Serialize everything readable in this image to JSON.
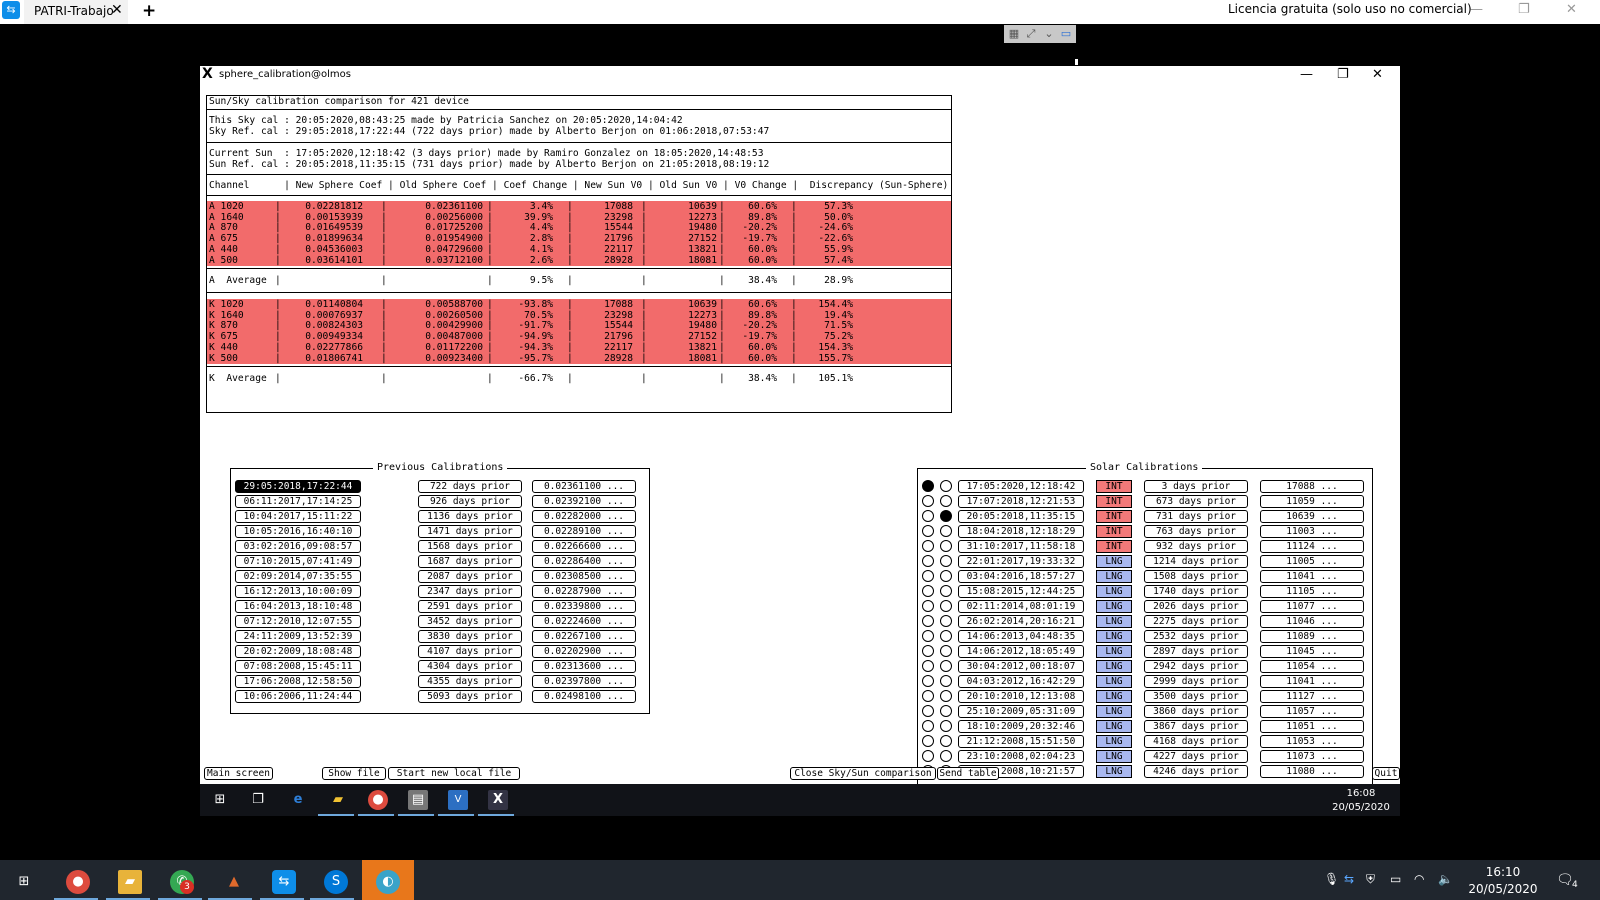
{
  "teamviewer": {
    "tab_label": "PATRI-Trabajo",
    "close_glyph": "✕",
    "new_tab_glyph": "+",
    "license_text": "Licencia gratuita (solo uso no comercial)",
    "min_glyph": "—",
    "max_glyph": "❐",
    "close_win_glyph": "✕"
  },
  "xwindow": {
    "title": "sphere_calibration@olmos",
    "min_glyph": "—",
    "max_glyph": "❐",
    "close_glyph": "✕"
  },
  "comparison": {
    "header": "Sun/Sky calibration comparison for 421 device",
    "sky_cal": "This Sky cal : 20:05:2020,08:43:25 made by Patricia Sanchez on 20:05:2020,14:04:42",
    "sky_ref": "Sky Ref. cal : 29:05:2018,17:22:44 (722 days prior) made by Alberto Berjon on 01:06:2018,07:53:47",
    "sun_cur": "Current Sun  : 17:05:2020,12:18:42 (3 days prior) made by Ramiro Gonzalez on 18:05:2020,14:48:53",
    "sun_ref": "Sun Ref. cal : 20:05:2018,11:35:15 (731 days prior) made by Alberto Berjon on 21:05:2018,08:19:12",
    "columns": "Channel      | New Sphere Coef | Old Sphere Coef | Coef Change | New Sun V0 | Old Sun V0 | V0 Change |  Discrepancy (Sun-Sphere)",
    "a_rows": [
      [
        "A 1020",
        "0.02281812",
        "0.02361100",
        "3.4%",
        "17088",
        "10639",
        "60.6%",
        "57.3%"
      ],
      [
        "A 1640",
        "0.00153939",
        "0.00256000",
        "39.9%",
        "23298",
        "12273",
        "89.8%",
        "50.0%"
      ],
      [
        "A 870",
        "0.01649539",
        "0.01725200",
        "4.4%",
        "15544",
        "19480",
        "-20.2%",
        "-24.6%"
      ],
      [
        "A 675",
        "0.01899634",
        "0.01954900",
        "2.8%",
        "21796",
        "27152",
        "-19.7%",
        "-22.6%"
      ],
      [
        "A 440",
        "0.04536003",
        "0.04729600",
        "4.1%",
        "22117",
        "13821",
        "60.0%",
        "55.9%"
      ],
      [
        "A 500",
        "0.03614101",
        "0.03712100",
        "2.6%",
        "28928",
        "18081",
        "60.0%",
        "57.4%"
      ]
    ],
    "a_avg": {
      "label": "A  Average",
      "coef": "9.5%",
      "v0": "38.4%",
      "disc": "28.9%"
    },
    "k_rows": [
      [
        "K 1020",
        "0.01140804",
        "0.00588700",
        "-93.8%",
        "17088",
        "10639",
        "60.6%",
        "154.4%"
      ],
      [
        "K 1640",
        "0.00076937",
        "0.00260500",
        "70.5%",
        "23298",
        "12273",
        "89.8%",
        "19.4%"
      ],
      [
        "K 870",
        "0.00824303",
        "0.00429900",
        "-91.7%",
        "15544",
        "19480",
        "-20.2%",
        "71.5%"
      ],
      [
        "K 675",
        "0.00949334",
        "0.00487000",
        "-94.9%",
        "21796",
        "27152",
        "-19.7%",
        "75.2%"
      ],
      [
        "K 440",
        "0.02277866",
        "0.01172200",
        "-94.3%",
        "22117",
        "13821",
        "60.0%",
        "154.3%"
      ],
      [
        "K 500",
        "0.01806741",
        "0.00923400",
        "-95.7%",
        "28928",
        "18081",
        "60.0%",
        "155.7%"
      ]
    ],
    "k_avg": {
      "label": "K  Average",
      "coef": "-66.7%",
      "v0": "38.4%",
      "disc": "105.1%"
    }
  },
  "previous": {
    "title": "Previous Calibrations",
    "rows": [
      [
        "29:05:2018,17:22:44",
        "722 days prior",
        "0.02361100 ..."
      ],
      [
        "06:11:2017,17:14:25",
        "926 days prior",
        "0.02392100 ..."
      ],
      [
        "10:04:2017,15:11:22",
        "1136 days prior",
        "0.02282000 ..."
      ],
      [
        "10:05:2016,16:40:10",
        "1471 days prior",
        "0.02289100 ..."
      ],
      [
        "03:02:2016,09:08:57",
        "1568 days prior",
        "0.02266600 ..."
      ],
      [
        "07:10:2015,07:41:49",
        "1687 days prior",
        "0.02286400 ..."
      ],
      [
        "02:09:2014,07:35:55",
        "2087 days prior",
        "0.02308500 ..."
      ],
      [
        "16:12:2013,10:00:09",
        "2347 days prior",
        "0.02287900 ..."
      ],
      [
        "16:04:2013,18:10:48",
        "2591 days prior",
        "0.02339800 ..."
      ],
      [
        "07:12:2010,12:07:55",
        "3452 days prior",
        "0.02224600 ..."
      ],
      [
        "24:11:2009,13:52:39",
        "3830 days prior",
        "0.02267100 ..."
      ],
      [
        "20:02:2009,18:08:48",
        "4107 days prior",
        "0.02202900 ..."
      ],
      [
        "07:08:2008,15:45:11",
        "4304 days prior",
        "0.02313600 ..."
      ],
      [
        "17:06:2008,12:58:50",
        "4355 days prior",
        "0.02397800 ..."
      ],
      [
        "10:06:2006,11:24:44",
        "5093 days prior",
        "0.02498100 ..."
      ]
    ]
  },
  "solar": {
    "title": "Solar Calibrations",
    "rows": [
      [
        "17:05:2020,12:18:42",
        "INT",
        "3 days prior",
        "17088 ..."
      ],
      [
        "17:07:2018,12:21:53",
        "INT",
        "673 days prior",
        "11059 ..."
      ],
      [
        "20:05:2018,11:35:15",
        "INT",
        "731 days prior",
        "10639 ..."
      ],
      [
        "18:04:2018,12:18:29",
        "INT",
        "763 days prior",
        "11003 ..."
      ],
      [
        "31:10:2017,11:58:18",
        "INT",
        "932 days prior",
        "11124 ..."
      ],
      [
        "22:01:2017,19:33:32",
        "LNG",
        "1214 days prior",
        "11005 ..."
      ],
      [
        "03:04:2016,18:57:27",
        "LNG",
        "1508 days prior",
        "11041 ..."
      ],
      [
        "15:08:2015,12:44:25",
        "LNG",
        "1740 days prior",
        "11105 ..."
      ],
      [
        "02:11:2014,08:01:19",
        "LNG",
        "2026 days prior",
        "11077 ..."
      ],
      [
        "26:02:2014,20:16:21",
        "LNG",
        "2275 days prior",
        "11046 ..."
      ],
      [
        "14:06:2013,04:48:35",
        "LNG",
        "2532 days prior",
        "11089 ..."
      ],
      [
        "14:06:2012,18:05:49",
        "LNG",
        "2897 days prior",
        "11045 ..."
      ],
      [
        "30:04:2012,00:18:07",
        "LNG",
        "2942 days prior",
        "11054 ..."
      ],
      [
        "04:03:2012,16:42:29",
        "LNG",
        "2999 days prior",
        "11041 ..."
      ],
      [
        "20:10:2010,12:13:08",
        "LNG",
        "3500 days prior",
        "11127 ..."
      ],
      [
        "25:10:2009,05:31:09",
        "LNG",
        "3860 days prior",
        "11057 ..."
      ],
      [
        "18:10:2009,20:32:46",
        "LNG",
        "3867 days prior",
        "11051 ..."
      ],
      [
        "21:12:2008,15:51:50",
        "LNG",
        "4168 days prior",
        "11053 ..."
      ],
      [
        "23:10:2008,02:04:23",
        "LNG",
        "4227 days prior",
        "11073 ..."
      ],
      [
        "24:09:2008,10:21:57",
        "LNG",
        "4246 days prior",
        "11080 ..."
      ]
    ],
    "sun_selected": 0,
    "sky_selected": 2
  },
  "buttons": {
    "main_screen": "Main screen",
    "show_file": "Show file",
    "start_local": "Start new local file",
    "close_cmp": "Close Sky/Sun comparison",
    "send_table": "Send table",
    "quit": "Quit"
  },
  "remote_taskbar": {
    "time": "16:08",
    "date": "20/05/2020"
  },
  "local_taskbar": {
    "time": "16:10",
    "date": "20/05/2020",
    "whatsapp_badge": "3",
    "notif_count": "4"
  },
  "colors": {
    "int_tag": "#f27979",
    "lng_tag": "#a9b8f0",
    "bad_row": "#f26b6b"
  }
}
